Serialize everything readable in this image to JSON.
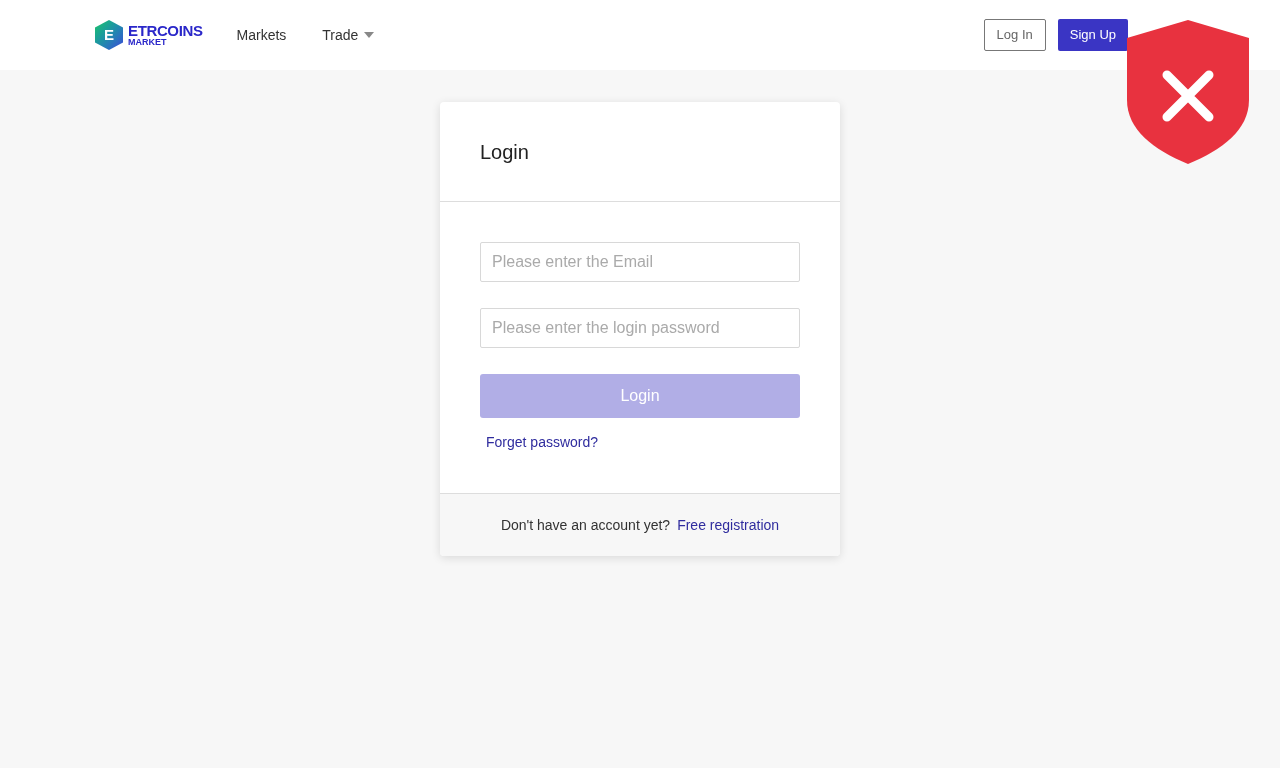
{
  "header": {
    "logo": {
      "letter": "E",
      "name": "ETRCOINS",
      "sub": "MARKET"
    },
    "nav": [
      {
        "label": "Markets",
        "kind": "link"
      },
      {
        "label": "Trade",
        "kind": "dropdown"
      }
    ],
    "login_button": "Log In",
    "signup_button": "Sign Up"
  },
  "login_card": {
    "title": "Login",
    "fields": [
      {
        "placeholder": "Please enter the Email"
      },
      {
        "placeholder": "Please enter the login password"
      }
    ],
    "submit": {
      "label": "Login",
      "disabled": true
    },
    "forgot_link": "Forget password?",
    "footer": {
      "text": "Don't have an account yet?",
      "link": "Free registration"
    }
  },
  "overlay": {
    "kind": "shield-blocked"
  }
}
